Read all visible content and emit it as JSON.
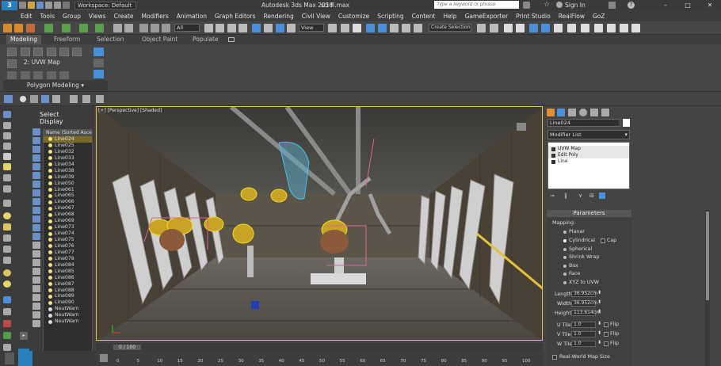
{
  "titlebar": {
    "workspace": "Workspace: Default",
    "app_title": "Autodesk 3ds Max 2016",
    "file_name": "sci fi.max",
    "search_placeholder": "Type a keyword or phrase",
    "sign_in": "Sign In"
  },
  "menu": [
    "Edit",
    "Tools",
    "Group",
    "Views",
    "Create",
    "Modifiers",
    "Animation",
    "Graph Editors",
    "Rendering",
    "Civil View",
    "Customize",
    "Scripting",
    "Content",
    "Help",
    "GameExporter",
    "Print Studio",
    "RealFlow",
    "GoZ"
  ],
  "toolbar": {
    "selection_filter": "All",
    "reference_coord": "View",
    "named_selection": "Create Selection Se"
  },
  "ribbon": {
    "tabs": [
      "Modeling",
      "Freeform",
      "Selection",
      "Object Paint",
      "Populate"
    ],
    "active_tab": "Modeling",
    "uvw_button": "2: UVW Map",
    "panel_title": "Polygon Modeling"
  },
  "scene_explorer": {
    "tabs": [
      "Select",
      "Display"
    ],
    "column_header": "Name (Sorted Ascendi",
    "items": [
      "Line024",
      "Line025",
      "Line032",
      "Line033",
      "Line034",
      "Line038",
      "Line039",
      "Line050",
      "Line061",
      "Line065",
      "Line066",
      "Line067",
      "Line068",
      "Line069",
      "Line073",
      "Line074",
      "Line075",
      "Line076",
      "Line077",
      "Line078",
      "Line084",
      "Line085",
      "Line086",
      "Line087",
      "Line088",
      "Line089",
      "Line090",
      "NeutWarn",
      "NeutWarn",
      "NeutWarn"
    ],
    "selected_index": 0
  },
  "viewport": {
    "label": "[+] [Perspective] [Shaded]"
  },
  "timeline": {
    "frame_display": "0 / 100",
    "ticks": [
      "0",
      "5",
      "10",
      "15",
      "20",
      "25",
      "30",
      "35",
      "40",
      "45",
      "50",
      "55",
      "60",
      "65",
      "70",
      "75",
      "80",
      "85",
      "90",
      "95",
      "100"
    ]
  },
  "command_panel": {
    "object_name": "Line024",
    "object_color": "#ffffff",
    "modifier_list": "Modifier List",
    "stack": [
      "UVW Map",
      "Edit Poly",
      "Line"
    ],
    "parameters_title": "Parameters",
    "mapping_label": "Mapping:",
    "mapping_options": [
      "Planar",
      "Cylindrical",
      "Spherical",
      "Shrink Wrap",
      "Box",
      "Face",
      "XYZ to UVW"
    ],
    "mapping_selected": "Cylindrical",
    "cap_label": "Cap",
    "length_label": "Length:",
    "length_value": "36.952cm",
    "width_label": "Width:",
    "width_value": "36.952cm",
    "height_label": "Height:",
    "height_value": "113.614cm",
    "utile_label": "U Tile:",
    "utile_value": "1.0",
    "vtile_label": "V Tile:",
    "vtile_value": "1.0",
    "wtile_label": "W Tile:",
    "wtile_value": "1.0",
    "flip_label": "Flip",
    "realworld_label": "Real-World Map Size"
  }
}
